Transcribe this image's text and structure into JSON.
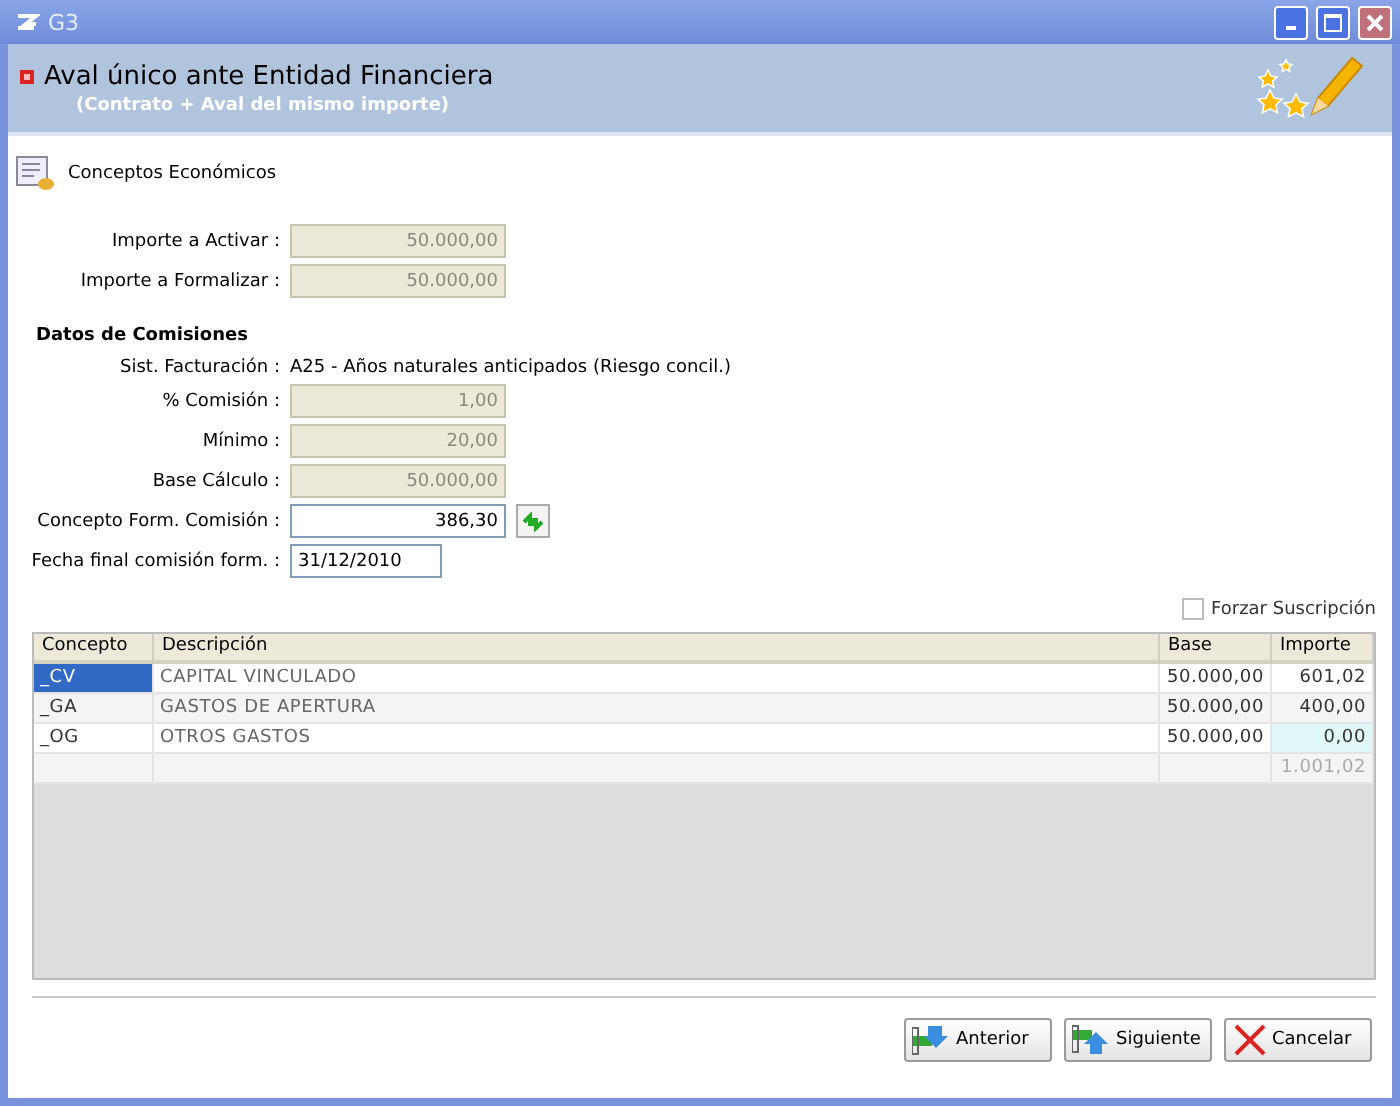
{
  "window": {
    "title": "G3"
  },
  "header": {
    "title": "Aval único ante Entidad Financiera",
    "subtitle": "(Contrato + Aval del mismo importe)"
  },
  "section": {
    "title": "Conceptos Económicos"
  },
  "amounts": [
    {
      "label": "Importe a Activar :",
      "value": "50.000,00",
      "disabled": true
    },
    {
      "label": "Importe a Formalizar :",
      "value": "50.000,00",
      "disabled": true
    }
  ],
  "commissions": {
    "title": "Datos de Comisiones",
    "billing_label": "Sist. Facturación  :",
    "billing_value": "A25 - Años naturales anticipados (Riesgo concil.)",
    "fields": [
      {
        "label": "% Comisión  :",
        "value": "1,00",
        "disabled": true,
        "kind": "number"
      },
      {
        "label": "Mínimo  :",
        "value": "20,00",
        "disabled": true,
        "kind": "number"
      },
      {
        "label": "Base Cálculo :",
        "value": "50.000,00",
        "disabled": true,
        "kind": "number"
      },
      {
        "label": "Concepto Form. Comisión :",
        "value": "386,30",
        "disabled": false,
        "kind": "refresh"
      },
      {
        "label": "Fecha final comisión form. :",
        "value": "31/12/2010",
        "disabled": false,
        "kind": "date"
      }
    ]
  },
  "force_subscription": {
    "label": "Forzar Suscripción",
    "checked": false
  },
  "table": {
    "columns": [
      "Concepto",
      "Descripción",
      "Base",
      "Importe"
    ],
    "rows": [
      {
        "cells": [
          "_CV",
          "CAPITAL VINCULADO",
          "50.000,00",
          "601,02"
        ],
        "selected": true,
        "editing": false
      },
      {
        "cells": [
          "_GA",
          "GASTOS DE APERTURA",
          "50.000,00",
          "400,00"
        ],
        "selected": false,
        "editing": false
      },
      {
        "cells": [
          "_OG",
          "OTROS GASTOS",
          "50.000,00",
          "0,00"
        ],
        "selected": false,
        "editing": true
      }
    ],
    "total": "1.001,02"
  },
  "buttons": [
    {
      "label": "Anterior",
      "kind": "back"
    },
    {
      "label": "Siguiente",
      "kind": "next"
    },
    {
      "label": "Cancelar",
      "kind": "cancel"
    }
  ]
}
